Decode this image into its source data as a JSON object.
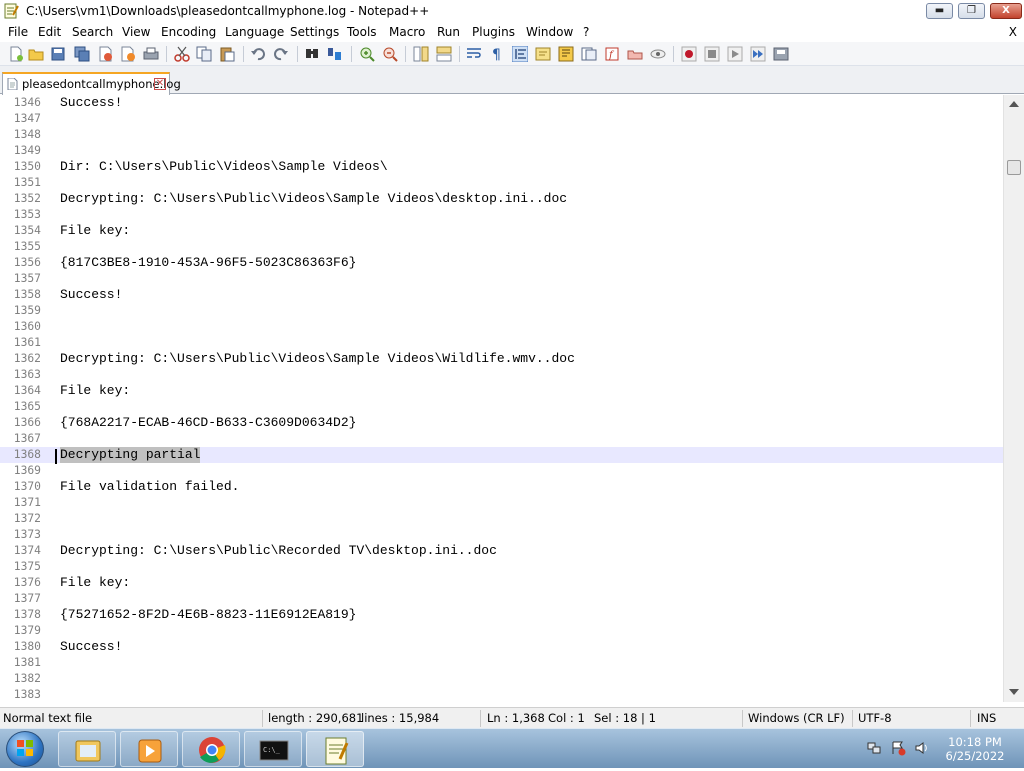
{
  "window": {
    "title": "C:\\Users\\vm1\\Downloads\\pleasedontcallmyphone.log - Notepad++",
    "min_glyph": "▬",
    "max_glyph": "❐",
    "close_glyph": "X"
  },
  "menubar": {
    "items": [
      "File",
      "Edit",
      "Search",
      "View",
      "Encoding",
      "Language",
      "Settings",
      "Tools",
      "Macro",
      "Run",
      "Plugins",
      "Window",
      "?"
    ],
    "close_doc": "X"
  },
  "toolbar": {
    "icons": [
      "new-file-icon",
      "open-file-icon",
      "save-icon",
      "save-all-icon",
      "close-icon",
      "close-all-icon",
      "print-icon",
      "cut-icon",
      "copy-icon",
      "paste-icon",
      "undo-icon",
      "redo-icon",
      "find-icon",
      "replace-icon",
      "zoom-in-icon",
      "zoom-out-icon",
      "sync-vertical-icon",
      "sync-horizontal-icon",
      "word-wrap-icon",
      "show-all-chars-icon",
      "indent-guide-icon",
      "user-lang-icon",
      "document-map-icon",
      "function-list-icon",
      "folder-workspace-icon",
      "monitoring-icon",
      "record-macro-icon",
      "stop-macro-icon",
      "play-macro-icon",
      "run-macro-multiple-icon",
      "save-macro-icon"
    ]
  },
  "tab": {
    "name": "pleasedontcallmyphone.log",
    "close_glyph": "✕"
  },
  "editor": {
    "current_line": "1368",
    "lines": [
      {
        "n": "1346",
        "text": "Success!"
      },
      {
        "n": "1347",
        "text": ""
      },
      {
        "n": "1348",
        "text": ""
      },
      {
        "n": "1349",
        "text": ""
      },
      {
        "n": "1350",
        "text": "Dir: C:\\Users\\Public\\Videos\\Sample Videos\\"
      },
      {
        "n": "1351",
        "text": ""
      },
      {
        "n": "1352",
        "text": "Decrypting: C:\\Users\\Public\\Videos\\Sample Videos\\desktop.ini..doc"
      },
      {
        "n": "1353",
        "text": ""
      },
      {
        "n": "1354",
        "text": "File key:"
      },
      {
        "n": "1355",
        "text": ""
      },
      {
        "n": "1356",
        "text": "{817C3BE8-1910-453A-96F5-5023C86363F6}"
      },
      {
        "n": "1357",
        "text": ""
      },
      {
        "n": "1358",
        "text": "Success!"
      },
      {
        "n": "1359",
        "text": ""
      },
      {
        "n": "1360",
        "text": ""
      },
      {
        "n": "1361",
        "text": ""
      },
      {
        "n": "1362",
        "text": "Decrypting: C:\\Users\\Public\\Videos\\Sample Videos\\Wildlife.wmv..doc"
      },
      {
        "n": "1363",
        "text": ""
      },
      {
        "n": "1364",
        "text": "File key:"
      },
      {
        "n": "1365",
        "text": ""
      },
      {
        "n": "1366",
        "text": "{768A2217-ECAB-46CD-B633-C3609D0634D2}"
      },
      {
        "n": "1367",
        "text": ""
      },
      {
        "n": "1368",
        "text": "Decrypting partial",
        "selected": true
      },
      {
        "n": "1369",
        "text": ""
      },
      {
        "n": "1370",
        "text": "File validation failed."
      },
      {
        "n": "1371",
        "text": ""
      },
      {
        "n": "1372",
        "text": ""
      },
      {
        "n": "1373",
        "text": ""
      },
      {
        "n": "1374",
        "text": "Decrypting: C:\\Users\\Public\\Recorded TV\\desktop.ini..doc"
      },
      {
        "n": "1375",
        "text": ""
      },
      {
        "n": "1376",
        "text": "File key:"
      },
      {
        "n": "1377",
        "text": ""
      },
      {
        "n": "1378",
        "text": "{75271652-8F2D-4E6B-8823-11E6912EA819}"
      },
      {
        "n": "1379",
        "text": ""
      },
      {
        "n": "1380",
        "text": "Success!"
      },
      {
        "n": "1381",
        "text": ""
      },
      {
        "n": "1382",
        "text": ""
      },
      {
        "n": "1383",
        "text": ""
      }
    ]
  },
  "statusbar": {
    "file_type": "Normal text file",
    "length": "length : 290,681",
    "lines": "lines : 15,984",
    "ln": "Ln : 1,368",
    "col": "Col : 1",
    "sel": "Sel : 18 | 1",
    "eol": "Windows (CR LF)",
    "encoding": "UTF-8",
    "mode": "INS"
  },
  "taskbar": {
    "apps": [
      "windows-explorer-icon",
      "media-player-icon",
      "chrome-icon",
      "command-prompt-icon",
      "notepad-plus-plus-icon"
    ],
    "clock_time": "10:18 PM",
    "clock_date": "6/25/2022"
  }
}
